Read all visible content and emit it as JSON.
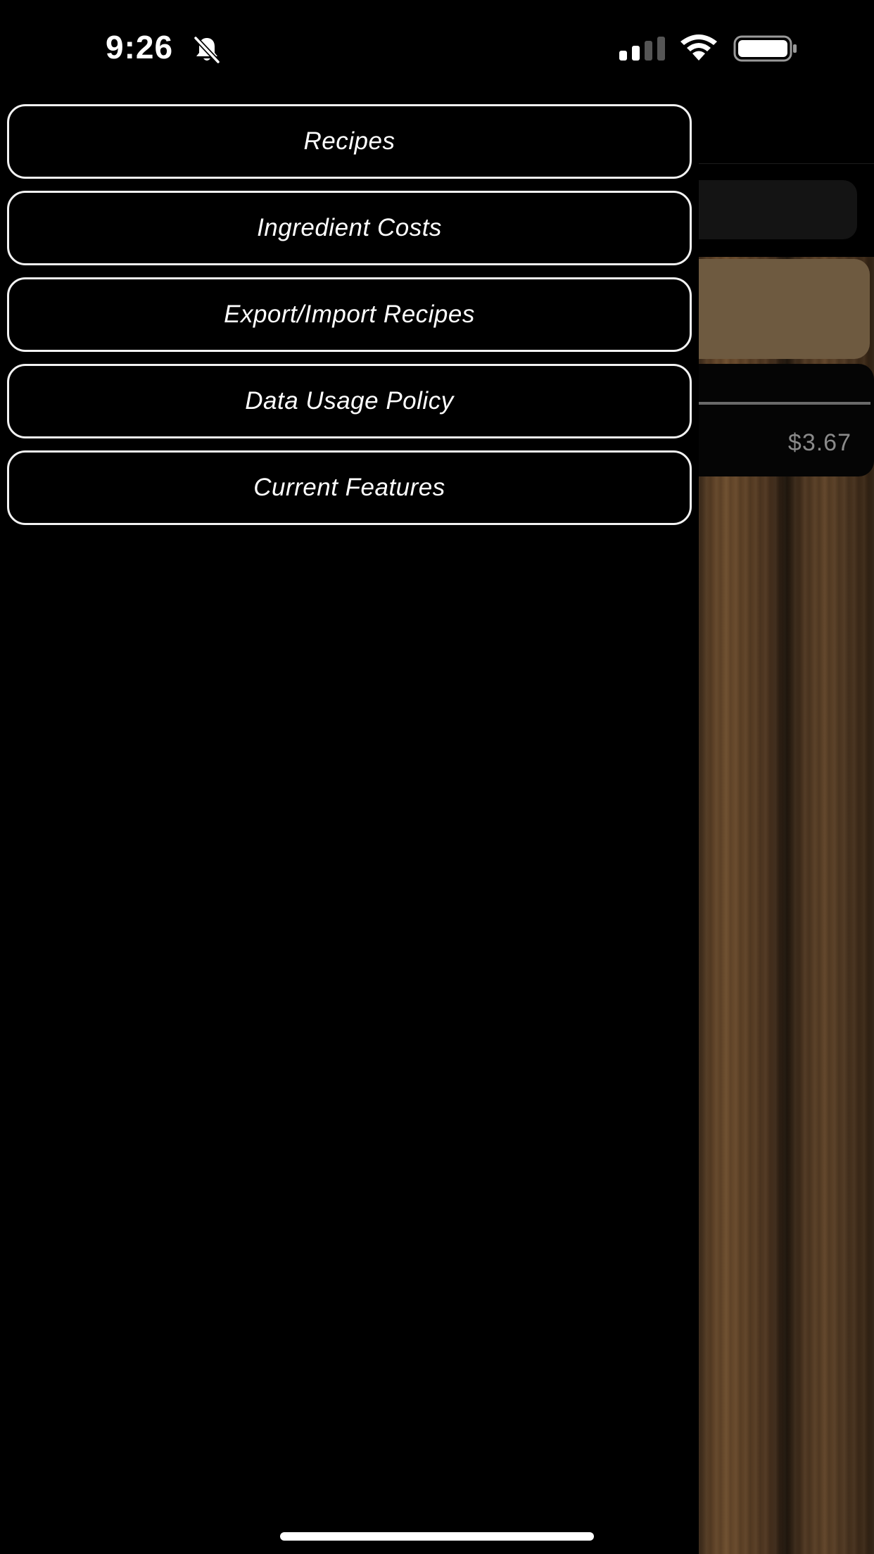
{
  "status_bar": {
    "time": "9:26",
    "icons": [
      "bell-slash-icon",
      "cellular-signal-icon",
      "wifi-icon",
      "battery-icon"
    ]
  },
  "menu": {
    "items": [
      {
        "label": "Recipes"
      },
      {
        "label": "Ingredient Costs"
      },
      {
        "label": "Export/Import Recipes"
      },
      {
        "label": "Data Usage Policy"
      },
      {
        "label": "Current Features"
      }
    ]
  },
  "background_app": {
    "price": "$3.67"
  },
  "colors": {
    "background": "#000000",
    "menu_border": "#f2f2f2",
    "menu_text": "#ffffff",
    "tan_card": "#6e5a40",
    "price_text": "#8a8a8a"
  }
}
